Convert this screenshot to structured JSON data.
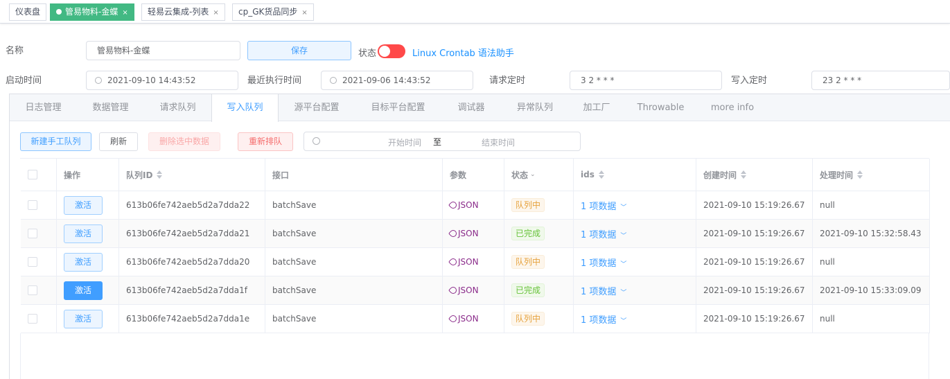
{
  "tags": [
    {
      "label": "仪表盘",
      "active": false,
      "closable": false
    },
    {
      "label": "管易物料-金蝶",
      "active": true,
      "closable": true
    },
    {
      "label": "轻易云集成-列表",
      "active": false,
      "closable": true
    },
    {
      "label": "cp_GK货品同步",
      "active": false,
      "closable": true
    }
  ],
  "close_glyph": "×",
  "form": {
    "name_label": "名称",
    "name_value": "管易物料-金蝶",
    "save_label": "保存",
    "status_label": "状态",
    "help_link": "Linux Crontab 语法助手",
    "start_label": "启动时间",
    "start_value": "2021-09-10 14:43:52",
    "last_label": "最近执行时间",
    "last_value": "2021-09-06 14:43:52",
    "req_label": "请求定时",
    "req_value": "3 2 * * *",
    "write_label": "写入定时",
    "write_value": "23 2 * * *"
  },
  "tabs": [
    "日志管理",
    "数据管理",
    "请求队列",
    "写入队列",
    "源平台配置",
    "目标平台配置",
    "调试器",
    "异常队列",
    "加工厂",
    "Throwable",
    "more info"
  ],
  "active_tab": "写入队列",
  "toolbar": {
    "new_queue": "新建手工队列",
    "refresh": "刷新",
    "delete_selected": "删除选中数据",
    "requeue": "重新排队",
    "start_placeholder": "开始时间",
    "range_sep": "至",
    "end_placeholder": "结束时间"
  },
  "table": {
    "headers": {
      "action": "操作",
      "queue_id": "队列ID",
      "api": "接口",
      "params": "参数",
      "status": "状态",
      "ids": "ids",
      "created": "创建时间",
      "processed": "处理时间"
    },
    "rows": [
      {
        "action": "激活",
        "queue_id": "613b06fe742aeb5d2a7dda22",
        "api": "batchSave",
        "params": "JSON",
        "status": "队列中",
        "ids": "1 项数据",
        "created": "2021-09-10 15:19:26.67",
        "processed": "null"
      },
      {
        "action": "激活",
        "queue_id": "613b06fe742aeb5d2a7dda21",
        "api": "batchSave",
        "params": "JSON",
        "status": "已完成",
        "ids": "1 项数据",
        "created": "2021-09-10 15:19:26.67",
        "processed": "2021-09-10 15:32:58.43"
      },
      {
        "action": "激活",
        "queue_id": "613b06fe742aeb5d2a7dda20",
        "api": "batchSave",
        "params": "JSON",
        "status": "队列中",
        "ids": "1 项数据",
        "created": "2021-09-10 15:19:26.67",
        "processed": "null"
      },
      {
        "action": "激活",
        "queue_id": "613b06fe742aeb5d2a7dda1f",
        "api": "batchSave",
        "params": "JSON",
        "status": "已完成",
        "ids": "1 项数据",
        "created": "2021-09-10 15:19:26.67",
        "processed": "2021-09-10 15:33:09.09"
      },
      {
        "action": "激活",
        "queue_id": "613b06fe742aeb5d2a7dda1e",
        "api": "batchSave",
        "params": "JSON",
        "status": "队列中",
        "ids": "1 项数据",
        "created": "2021-09-10 15:19:26.67",
        "processed": "null"
      }
    ]
  },
  "colors": {
    "accent": "#409eff",
    "active_tag": "#42b983",
    "toggle_off": "#ff4949",
    "status_pending": "#e6a23c",
    "status_done": "#67c23a"
  }
}
